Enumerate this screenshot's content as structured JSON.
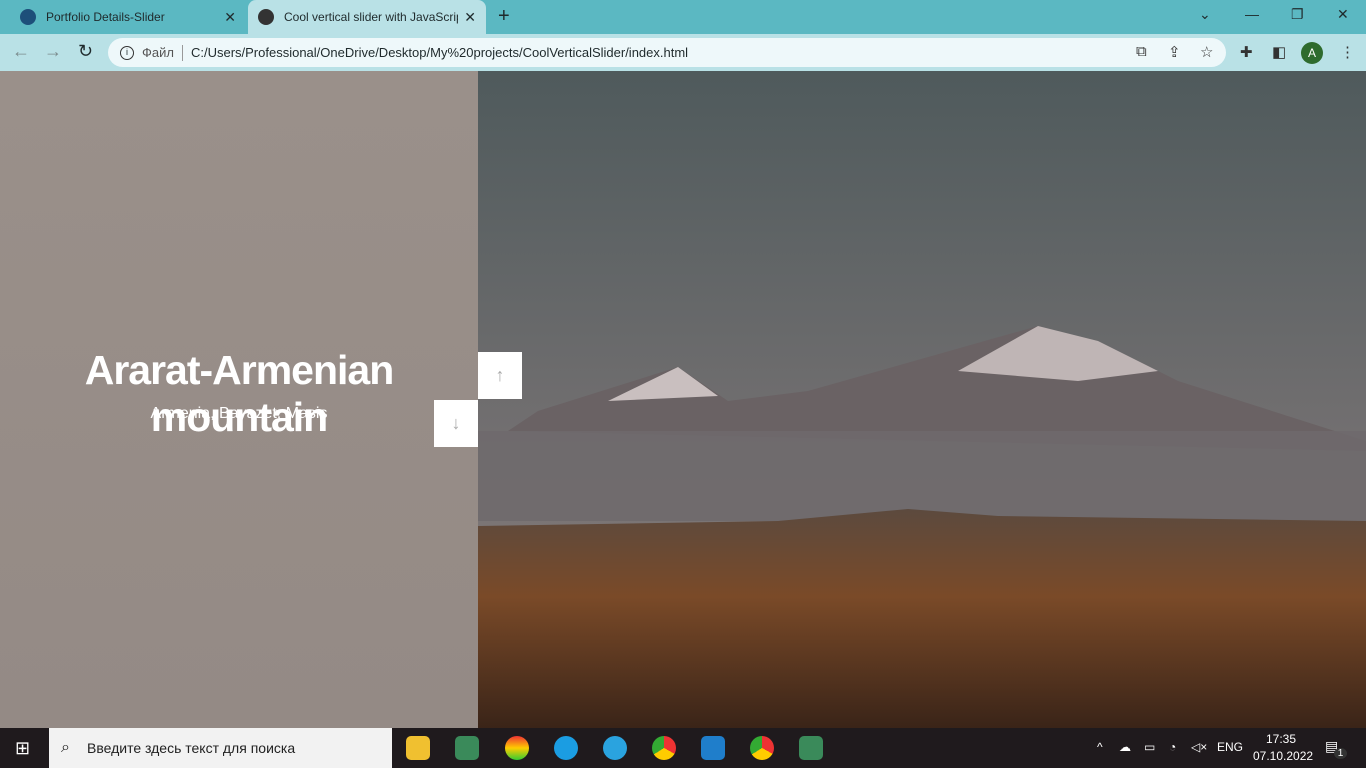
{
  "browser": {
    "tabs": [
      {
        "title": "Portfolio Details-Slider"
      },
      {
        "title": "Cool vertical slider with JavaScript"
      }
    ],
    "file_label": "Файл",
    "url": "C:/Users/Professional/OneDrive/Desktop/My%20projects/CoolVerticalSlider/index.html",
    "avatar": "A"
  },
  "slide": {
    "title": "Ararat-Armenian mountain",
    "subtitle": "Armenia, Bayazet, Masis"
  },
  "taskbar": {
    "search_placeholder": "Введите здесь текст для поиска",
    "lang": "ENG",
    "time": "17:35",
    "date": "07.10.2022",
    "notifications": "1"
  }
}
